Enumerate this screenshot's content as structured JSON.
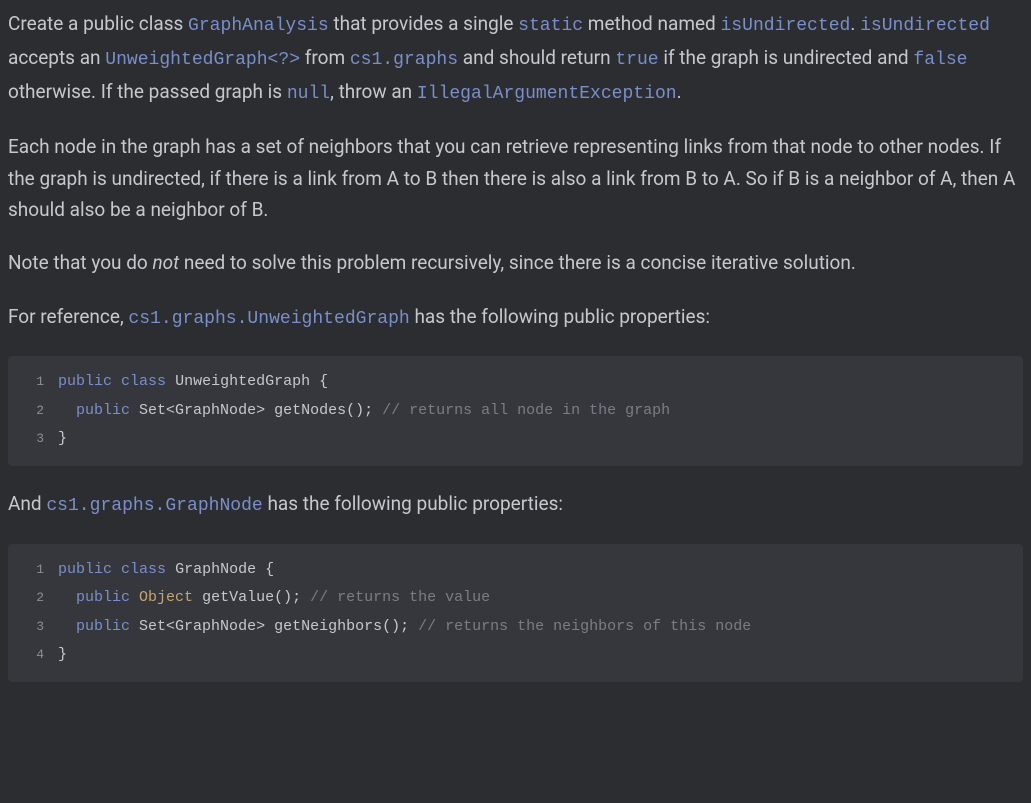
{
  "para1": {
    "t1": "Create a public class ",
    "c1": "GraphAnalysis",
    "t2": " that provides a single ",
    "c2": "static",
    "t3": " method named ",
    "c3": "isUndirected",
    "t4": ". ",
    "c4": "isUndirected",
    "t5": " accepts an ",
    "c5": "UnweightedGraph<?>",
    "t6": " from ",
    "c6": "cs1.graphs",
    "t7": " and should return ",
    "c7": "true",
    "t8": " if the graph is undirected and ",
    "c8": "false",
    "t9": " otherwise. If the passed graph is ",
    "c9": "null",
    "t10": ", throw an ",
    "c10": "IllegalArgumentException",
    "t11": "."
  },
  "para2": "Each node in the graph has a set of neighbors that you can retrieve representing links from that node to other nodes. If the graph is undirected, if there is a link from A to B then there is also a link from B to A. So if B is a neighbor of A, then A should also be a neighbor of B.",
  "para3": {
    "t1": "Note that you do ",
    "i1": "not",
    "t2": " need to solve this problem recursively, since there is a concise iterative solution."
  },
  "para4": {
    "t1": "For reference, ",
    "c1": "cs1.graphs.UnweightedGraph",
    "t2": " has the following public properties:"
  },
  "code1": {
    "lines": [
      "1",
      "2",
      "3"
    ],
    "l1": {
      "kw1": "public",
      "kw2": "class",
      "name": "UnweightedGraph",
      "brace": "{"
    },
    "l2": {
      "indent": "  ",
      "kw1": "public",
      "ret": "Set<GraphNode>",
      "method": "getNodes",
      "parens": "();",
      "comment": " // returns all node in the graph"
    },
    "l3": {
      "brace": "}"
    }
  },
  "para5": {
    "t1": "And ",
    "c1": "cs1.graphs.GraphNode",
    "t2": " has the following public properties:"
  },
  "code2": {
    "lines": [
      "1",
      "2",
      "3",
      "4"
    ],
    "l1": {
      "kw1": "public",
      "kw2": "class",
      "name": "GraphNode",
      "brace": "{"
    },
    "l2": {
      "indent": "  ",
      "kw1": "public",
      "ret": "Object",
      "method": "getValue",
      "parens": "();",
      "comment": " // returns the value"
    },
    "l3": {
      "indent": "  ",
      "kw1": "public",
      "ret": "Set<GraphNode>",
      "method": "getNeighbors",
      "parens": "();",
      "comment": " // returns the neighbors of this node"
    },
    "l4": {
      "brace": "}"
    }
  }
}
